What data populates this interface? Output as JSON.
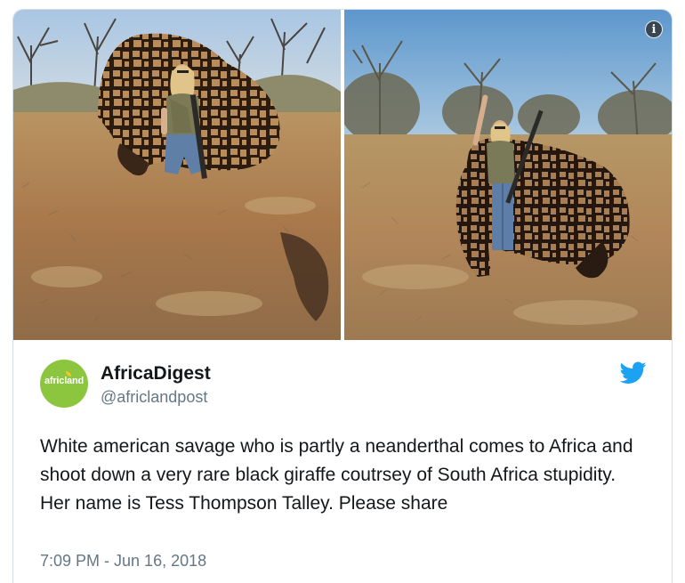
{
  "tweet": {
    "display_name": "AfricaDigest",
    "handle": "@africlandpost",
    "avatar_text": "africland",
    "text": "White american savage who is partly a neanderthal comes to Africa and shoot down a very rare black giraffe coutrsey of South Africa stupidity. Her name is Tess Thompson Talley. Please share",
    "timestamp": "7:09 PM - Jun 16, 2018"
  },
  "media": {
    "info_glyph": "i",
    "photos": [
      "hunter-kneeling-with-giraffe-photo",
      "hunter-standing-with-giraffe-photo"
    ]
  },
  "icons": {
    "info": "info-icon",
    "platform": "twitter-bird-icon"
  },
  "colors": {
    "brand_blue": "#1da1f2",
    "avatar_green": "#8cc63f",
    "secondary_text": "#657786"
  }
}
